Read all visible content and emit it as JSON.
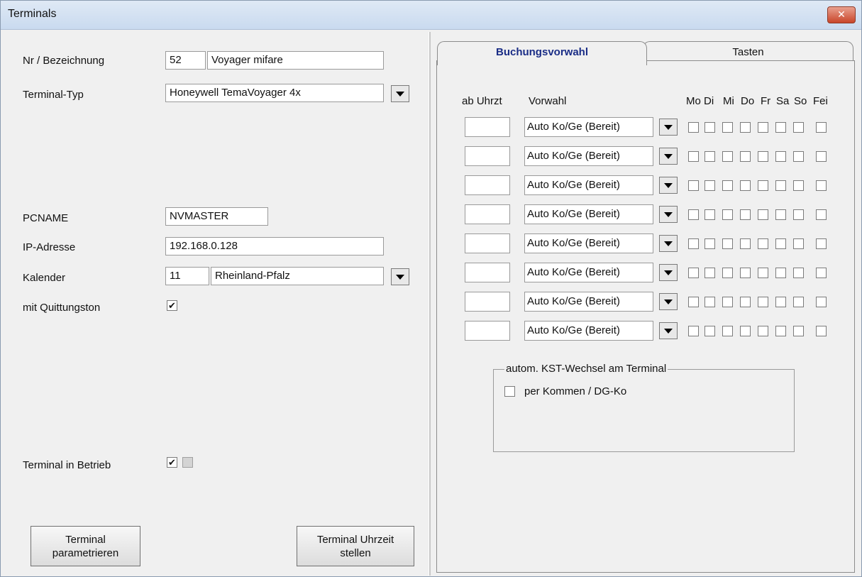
{
  "window": {
    "title": "Terminals",
    "close_glyph": "✕"
  },
  "left": {
    "nr_label": "Nr / Bezeichnung",
    "nr_value": "52",
    "bezeichnung_value": "Voyager mifare",
    "typ_label": "Terminal-Typ",
    "typ_value": "Honeywell TemaVoyager 4x",
    "pcname_label": "PCNAME",
    "pcname_value": "NVMASTER",
    "ip_label": "IP-Adresse",
    "ip_value": "192.168.0.128",
    "kalender_label": "Kalender",
    "kalender_nr": "11",
    "kalender_value": "Rheinland-Pfalz",
    "quittung_label": "mit Quittungston",
    "quittung_checked": "✔",
    "betrieb_label": "Terminal  in  Betrieb",
    "betrieb_checked": "✔",
    "param_button": "Terminal\nparametrieren",
    "uhrzeit_button": "Terminal Uhrzeit\nstellen"
  },
  "tabs": [
    {
      "label": "Buchungsvorwahl",
      "active": true
    },
    {
      "label": "Tasten",
      "active": false
    }
  ],
  "buchung": {
    "col_time": "ab Uhrzt",
    "col_vorwahl": "Vorwahl",
    "days": [
      "Mo",
      "Di",
      "Mi",
      "Do",
      "Fr",
      "Sa",
      "So",
      "Fei"
    ],
    "rows": [
      {
        "time": "",
        "vorwahl": "Auto Ko/Ge (Bereit)"
      },
      {
        "time": "",
        "vorwahl": "Auto Ko/Ge (Bereit)"
      },
      {
        "time": "",
        "vorwahl": "Auto Ko/Ge (Bereit)"
      },
      {
        "time": "",
        "vorwahl": "Auto Ko/Ge (Bereit)"
      },
      {
        "time": "",
        "vorwahl": "Auto Ko/Ge (Bereit)"
      },
      {
        "time": "",
        "vorwahl": "Auto Ko/Ge (Bereit)"
      },
      {
        "time": "",
        "vorwahl": "Auto Ko/Ge (Bereit)"
      },
      {
        "time": "",
        "vorwahl": "Auto Ko/Ge (Bereit)"
      }
    ],
    "kst_group_title": "autom. KST-Wechsel am Terminal",
    "kst_option": "per  Kommen / DG-Ko"
  }
}
